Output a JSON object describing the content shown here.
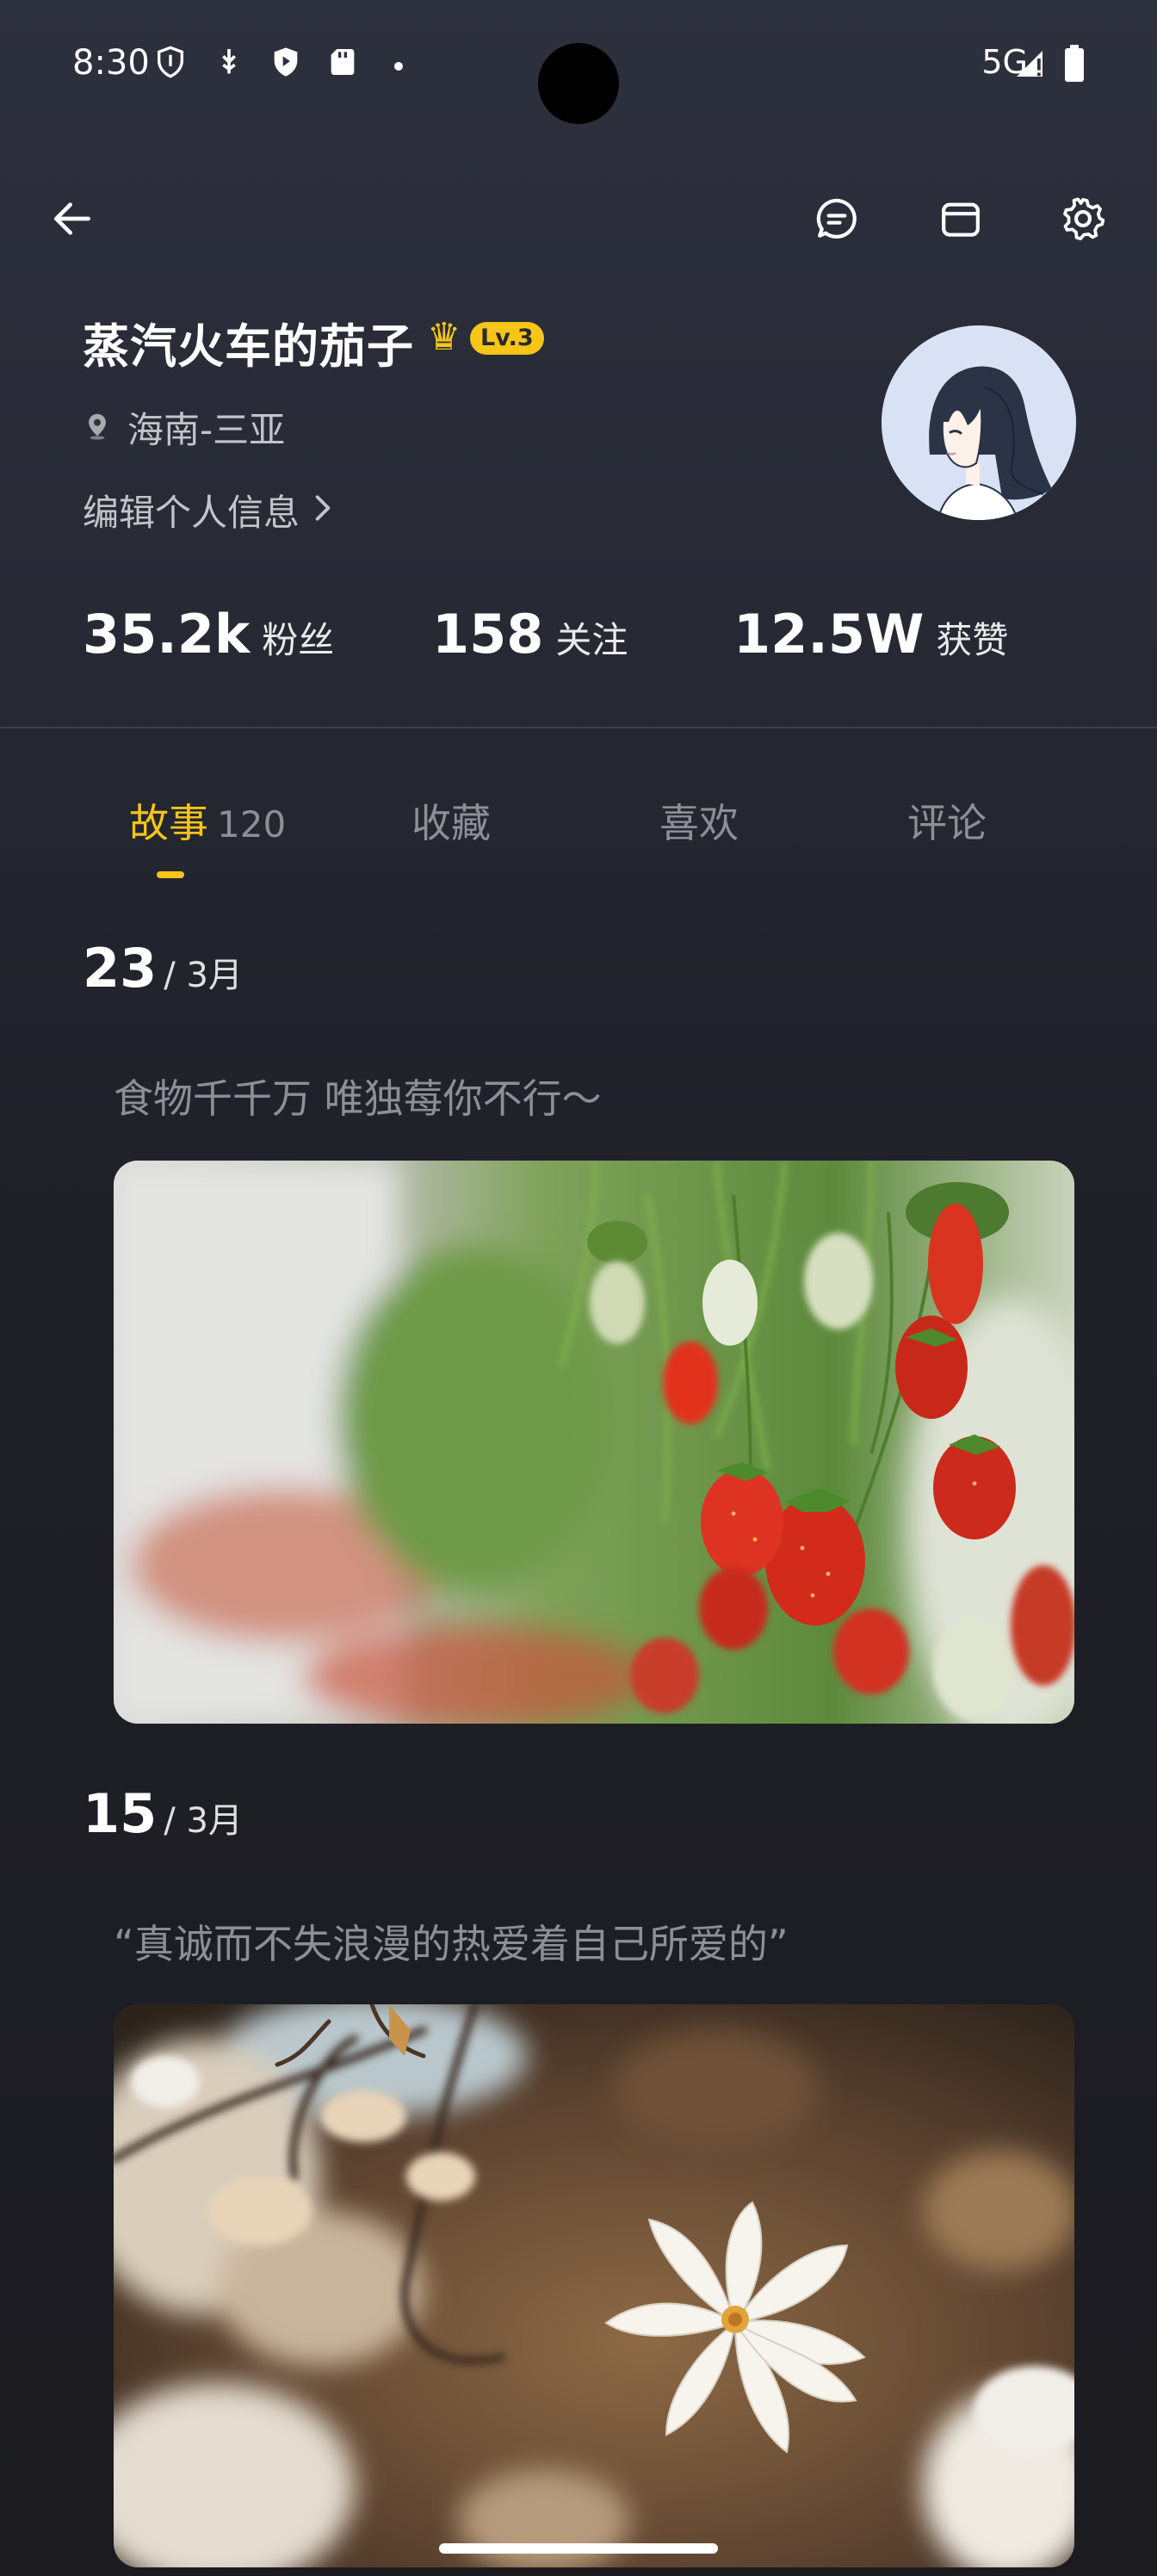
{
  "status_bar": {
    "time": "8:30",
    "network": "5G",
    "icons": [
      "shield-outline-icon",
      "usb-debug-icon",
      "shield-play-icon",
      "sd-card-icon",
      "dot-icon",
      "signal-icon",
      "battery-icon"
    ]
  },
  "header": {
    "icons": [
      "back-arrow-icon",
      "chat-bubble-icon",
      "calendar-icon",
      "gear-icon"
    ]
  },
  "profile": {
    "name": "蒸汽火车的茄子",
    "level": "Lv.3",
    "location": "海南-三亚",
    "edit_label": "编辑个人信息",
    "stats": [
      {
        "value": "35.2k",
        "label": "粉丝"
      },
      {
        "value": "158",
        "label": "关注"
      },
      {
        "value": "12.5W",
        "label": "获赞"
      }
    ]
  },
  "tabs": [
    {
      "label": "故事",
      "count": "120",
      "active": true
    },
    {
      "label": "收藏",
      "active": false
    },
    {
      "label": "喜欢",
      "active": false
    },
    {
      "label": "评论",
      "active": false
    }
  ],
  "entries": [
    {
      "day": "23",
      "month": "/ 3月",
      "text": "食物千千万 唯独莓你不行～",
      "image": "strawberries-photo"
    },
    {
      "day": "15",
      "month": "/ 3月",
      "text": "“真诚而不失浪漫的热爱着自己所爱的”",
      "image": "magnolia-flower-photo"
    }
  ],
  "colors": {
    "accent": "#f5c518",
    "background": "#2d303d",
    "muted_text": "#8e8f96"
  }
}
